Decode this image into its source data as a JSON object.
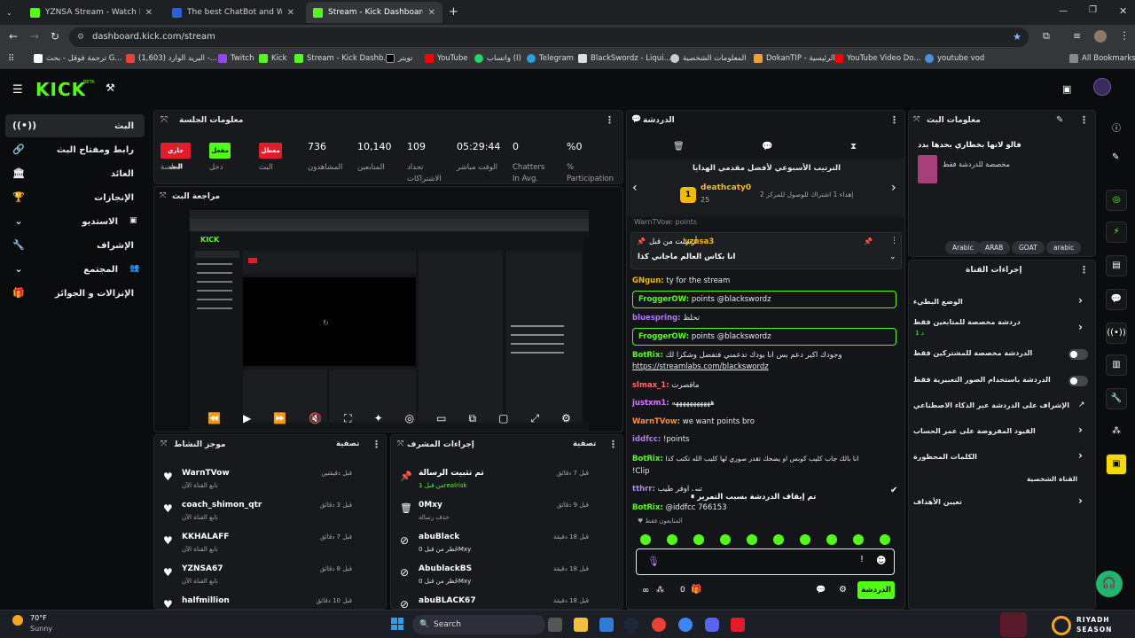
{
  "browser": {
    "tabs": [
      {
        "title": "YZNSA Stream - Watch Live on",
        "active": false
      },
      {
        "title": "The best ChatBot and Widgets",
        "active": false
      },
      {
        "title": "Stream - Kick Dashboard",
        "active": true
      }
    ],
    "url": "dashboard.kick.com/stream",
    "bookmarks": [
      "ترجمة قوقل - بحث G...",
      "البريد الوارد (1,603) -...",
      "Twitch",
      "Kick",
      "Stream - Kick Dashb...",
      "تويتر",
      "YouTube",
      "واتساب (I)",
      "Telegram",
      "BlackSwordz - Liqui...",
      "المعلومات الشخصية",
      "DokanTIP - الرئيسية",
      "YouTube Video Do...",
      "youtube vod"
    ],
    "all_bookmarks": "All Bookmarks"
  },
  "brand": {
    "logo": "KICK",
    "beta": "BETA",
    "accent": "#53fc18"
  },
  "sidebar": {
    "items": [
      {
        "label": "البث",
        "icon": "broadcast-icon"
      },
      {
        "label": "رابط ومفتاح البث",
        "icon": "link-icon"
      },
      {
        "label": "العائد",
        "icon": "bank-icon"
      },
      {
        "label": "الإنجازات",
        "icon": "trophy-icon"
      },
      {
        "label": "الاستديو",
        "icon": "chevron-down-icon"
      },
      {
        "label": "الإشراف",
        "icon": "wrench-icon"
      },
      {
        "label": "المجتمع",
        "icon": "chevron-down-icon"
      },
      {
        "label": "الإنزالات و الجوائز",
        "icon": "gift-icon"
      }
    ]
  },
  "session": {
    "title": "معلومات الجلسة",
    "badges": {
      "live": "جاري البث",
      "enabled": "مفعل",
      "disabled": "معطل"
    },
    "badge_labels": [
      "الجلسة",
      "دخل",
      "البث"
    ],
    "stats": [
      {
        "value": "736",
        "label": "المشاهدون"
      },
      {
        "value": "10,140",
        "label": "المتابعين"
      },
      {
        "value": "109",
        "label": "تحداد الاشتراكات"
      },
      {
        "value": "05:29:44",
        "label": "الوقت مباشر"
      },
      {
        "value": "0",
        "label": "Chatters In Avg."
      },
      {
        "value": "%0",
        "label": "% Participation"
      }
    ]
  },
  "preview": {
    "title": "مراجعة البث"
  },
  "activity": {
    "title": "موجز النشاط",
    "filter": "تصفية",
    "items": [
      {
        "name": "WarnTVow",
        "sub": "تابع القناة الآن",
        "time": "قبل دقيقتين"
      },
      {
        "name": "coach_shimon_qtr",
        "sub": "تابع القناة الآن",
        "time": "قبل 3 دقائق"
      },
      {
        "name": "KKHALAFF",
        "sub": "تابع القناة الآن",
        "time": "قبل 7 دقائق"
      },
      {
        "name": "YZNSA67",
        "sub": "تابع القناة الآن",
        "time": "قبل 8 دقائق"
      },
      {
        "name": "halfmillion",
        "sub": "",
        "time": "قبل 10 دقائق"
      }
    ]
  },
  "mod": {
    "title": "إجراءات المشرف",
    "filter": "تصفية",
    "items": [
      {
        "name": "تم تثبيت الرسالة",
        "sub": "من قبل 1realrisk",
        "time": "قبل 7 دقائق"
      },
      {
        "name": "0Mxy",
        "sub": "حذف رسالة",
        "time": "قبل 9 دقائق"
      },
      {
        "name": "abuBlack",
        "sub": "حُظر من قبل 0Mxy",
        "time": "قبل 18 دقيقة"
      },
      {
        "name": "AbublackBS",
        "sub": "حُظر من قبل 0Mxy",
        "time": "قبل 18 دقيقة"
      },
      {
        "name": "abuBLACK67",
        "sub": "",
        "time": "قبل 18 دقيقة"
      }
    ]
  },
  "chat": {
    "title": "الدردشة",
    "leaderboard_title": "الترتيب الأسبوعي لأفضل مقدمي الهدايا",
    "leader_name": "deathcaty0",
    "leader_count": "25",
    "leader_note": "إهداء 1 اشتراك للوصول للمركز 2",
    "pinned_by": "أرسلت من قبل",
    "pinned_user": "yznsa3",
    "pinned_text": "انا بكاس العالم ماجاني كذا",
    "cut_line": "WarnTVow: points",
    "messages": [
      {
        "user": "GNgun:",
        "text": "ty for the stream"
      },
      {
        "user": "FroggerOW:",
        "text": "points @blackswordz"
      },
      {
        "user": "bluespring:",
        "text": "تحلظ"
      },
      {
        "user": "FroggerOW:",
        "text": "points @blackswordz"
      },
      {
        "user": "BotRix:",
        "text": "وجودك اكبر دعم بس انا بودك تدعمني فتفضل وشكرا لك"
      },
      {
        "user": "",
        "text": "https://streamlabs.com/blackswordz"
      },
      {
        "user": "slmax_1:",
        "text": "ماقصرت"
      },
      {
        "user": "justxm1:",
        "text": "هههههههههههه"
      },
      {
        "user": "WarnTVow:",
        "text": "we want points bro"
      },
      {
        "user": "iddfcc:",
        "text": "!points"
      },
      {
        "user": "BotRix:",
        "text": "انا بالك جاب كليب كوبس او يضحك تقدر صوري لها كليب الله تكتب كذا"
      },
      {
        "user": "",
        "text": "!Clip"
      },
      {
        "user": "tthrr:",
        "text": "تبي اوفر طيب"
      },
      {
        "user": "BotRix:",
        "text": "@iddfcc 766153"
      }
    ],
    "paused": "تم إيقاف الدردشة بسبب التمرير",
    "followers_only": "المتابعون فقط",
    "send_label": "الدردشة",
    "counter": "0"
  },
  "channel": {
    "title": "معلومات البث",
    "stream_title": "فالو لانها بخطاري بحدها بدد",
    "category": "مخصصة للدردشة فقط",
    "tags": [
      "Arabic",
      "ARAB",
      "GOAT",
      "arabic"
    ]
  },
  "actions": {
    "title": "إجراءات القناة",
    "rows": [
      {
        "label": "الوضع البطيء",
        "control": "chevron"
      },
      {
        "label": "دردشة مخصصة للمتابعين فقط",
        "sub": "1 د",
        "control": "chevron"
      },
      {
        "label": "الدردشة مخصصة للمشتركين فقط",
        "control": "toggle"
      },
      {
        "label": "الدردشة باستخدام الصور التعبيرية فقط",
        "control": "toggle"
      },
      {
        "label": "الإشراف على الدردشة عبر الذكاء الاصطناعي",
        "control": "external"
      },
      {
        "label": "القيود المفروضة على عمر الحساب",
        "control": "chevron"
      },
      {
        "label": "الكلمات المحظورة",
        "control": "chevron"
      }
    ],
    "section": "القناة الشخصية",
    "goals": "تعيين الأهداف"
  },
  "taskbar": {
    "temp": "70°F",
    "weather": "Sunny",
    "search": "Search",
    "riyadh1": "RIYADH",
    "riyadh2": "SEASON"
  }
}
